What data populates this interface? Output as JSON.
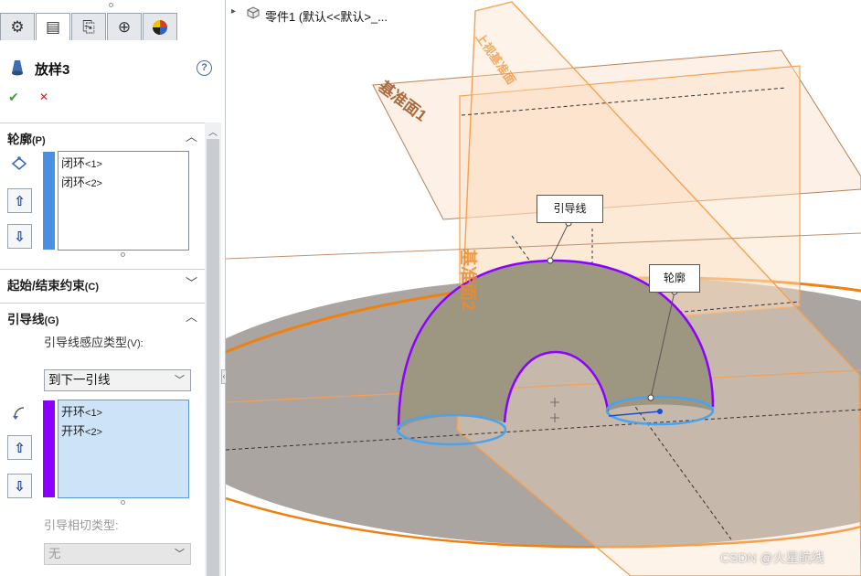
{
  "feature_manager": {
    "tabs": [
      {
        "icon": "feature-tree-icon"
      },
      {
        "icon": "property-manager-icon"
      },
      {
        "icon": "configuration-manager-icon"
      },
      {
        "icon": "dimxpert-icon"
      },
      {
        "icon": "display-manager-icon"
      }
    ],
    "feature_name": "放样3",
    "help_glyph": "?",
    "ok_glyph": "✔",
    "cancel_glyph": "✕"
  },
  "profiles": {
    "title": "轮廓",
    "hotkey": "(P)",
    "bar_color": "#4a90e2",
    "items": [
      {
        "name": "闭环",
        "index": "<1>"
      },
      {
        "name": "闭环",
        "index": "<2>"
      }
    ],
    "move_up_glyph": "⇧",
    "move_down_glyph": "⇩"
  },
  "start_end": {
    "title": "起始/结束约束",
    "hotkey": "(C)"
  },
  "guides": {
    "title": "引导线",
    "hotkey": "(G)",
    "influence_label": "引导线感应类型",
    "influence_hotkey": "(V):",
    "influence_value": "到下一引线",
    "bar_color": "#8b00ff",
    "items": [
      {
        "name": "开环",
        "index": "<1>"
      },
      {
        "name": "开环",
        "index": "<2>"
      }
    ],
    "tangency_label": "引导相切类型",
    "tangency_suffix": ":",
    "tangency_value": "无"
  },
  "viewport": {
    "tree_arrow": "▸",
    "part_title": "零件1 (默认<<默认>_...",
    "plane1_label": "基准面1",
    "plane2_label": "基准面2",
    "plane3_label": "上视基准面",
    "callout_guide": "引导线",
    "callout_profile": "轮廓",
    "watermark": "CSDN @火星航线",
    "colors": {
      "loft_edge": "#8b00ff",
      "profile_ring": "#4aa3ef",
      "plane_edge": "#f5a052",
      "base_ring": "#f08010"
    }
  }
}
